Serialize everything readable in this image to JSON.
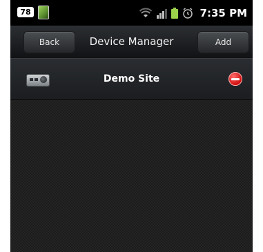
{
  "status_bar": {
    "badge": "78",
    "time": "7:35 PM"
  },
  "title_bar": {
    "back_label": "Back",
    "title": "Device Manager",
    "add_label": "Add"
  },
  "devices": [
    {
      "name": "Demo Site",
      "icon": "dvr-device-icon",
      "action_icon": "delete-icon"
    }
  ],
  "colors": {
    "delete_red": "#e31b1b",
    "background": "#1c1c1c"
  }
}
